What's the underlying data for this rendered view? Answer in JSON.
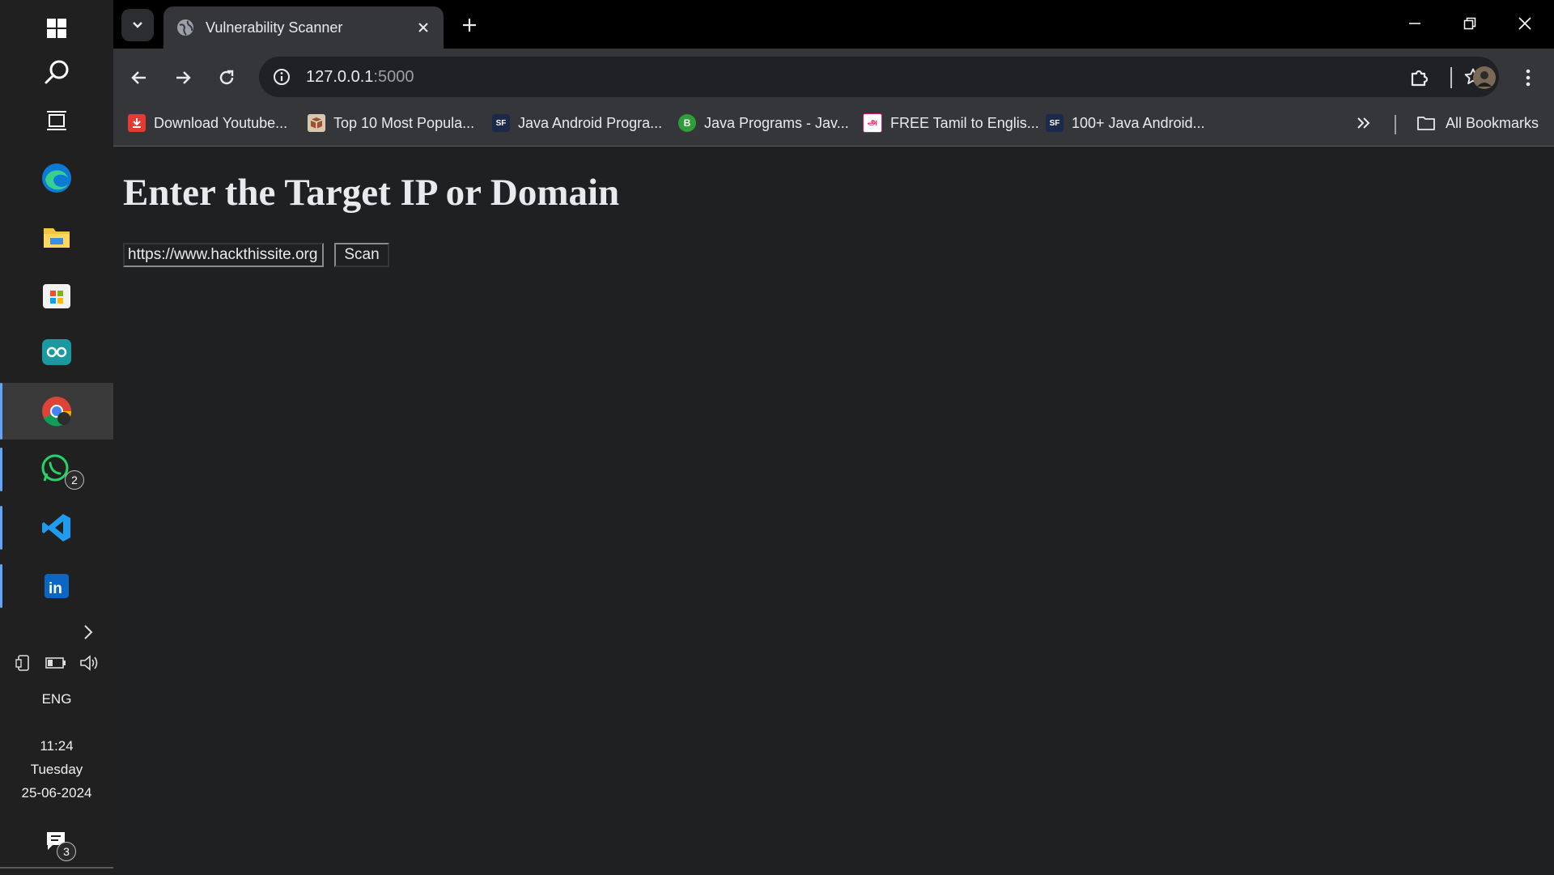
{
  "taskbar": {
    "apps": [
      {
        "name": "edge"
      },
      {
        "name": "file-explorer"
      },
      {
        "name": "microsoft-store"
      },
      {
        "name": "arduino"
      },
      {
        "name": "chrome",
        "active": true
      },
      {
        "name": "whatsapp",
        "badge": "2"
      },
      {
        "name": "vscode"
      },
      {
        "name": "linkedin"
      }
    ],
    "language": "ENG",
    "time": "11:24",
    "day": "Tuesday",
    "date": "25-06-2024",
    "notification_count": "3"
  },
  "browser": {
    "tab_title": "Vulnerability Scanner",
    "url_host": "127.0.0.1",
    "url_port": ":5000",
    "bookmarks": [
      {
        "label": "Download Youtube...",
        "icon": "download-red"
      },
      {
        "label": "Top 10 Most Popula...",
        "icon": "box"
      },
      {
        "label": "Java Android Progra...",
        "icon": "sf"
      },
      {
        "label": "Java Programs - Jav...",
        "icon": "b-green"
      },
      {
        "label": "FREE Tamil to Englis...",
        "icon": "tamil"
      },
      {
        "label": "100+ Java Android...",
        "icon": "sf"
      }
    ],
    "all_bookmarks_label": "All Bookmarks"
  },
  "page": {
    "heading": "Enter the Target IP or Domain",
    "target_value": "https://www.hackthissite.org",
    "scan_label": "Scan"
  },
  "colors": {
    "page_bg": "#1f2022",
    "toolbar_bg": "#35363a",
    "tabstrip_bg": "#000000",
    "taskbar_bg": "#202020",
    "accent": "#60a5fa"
  }
}
